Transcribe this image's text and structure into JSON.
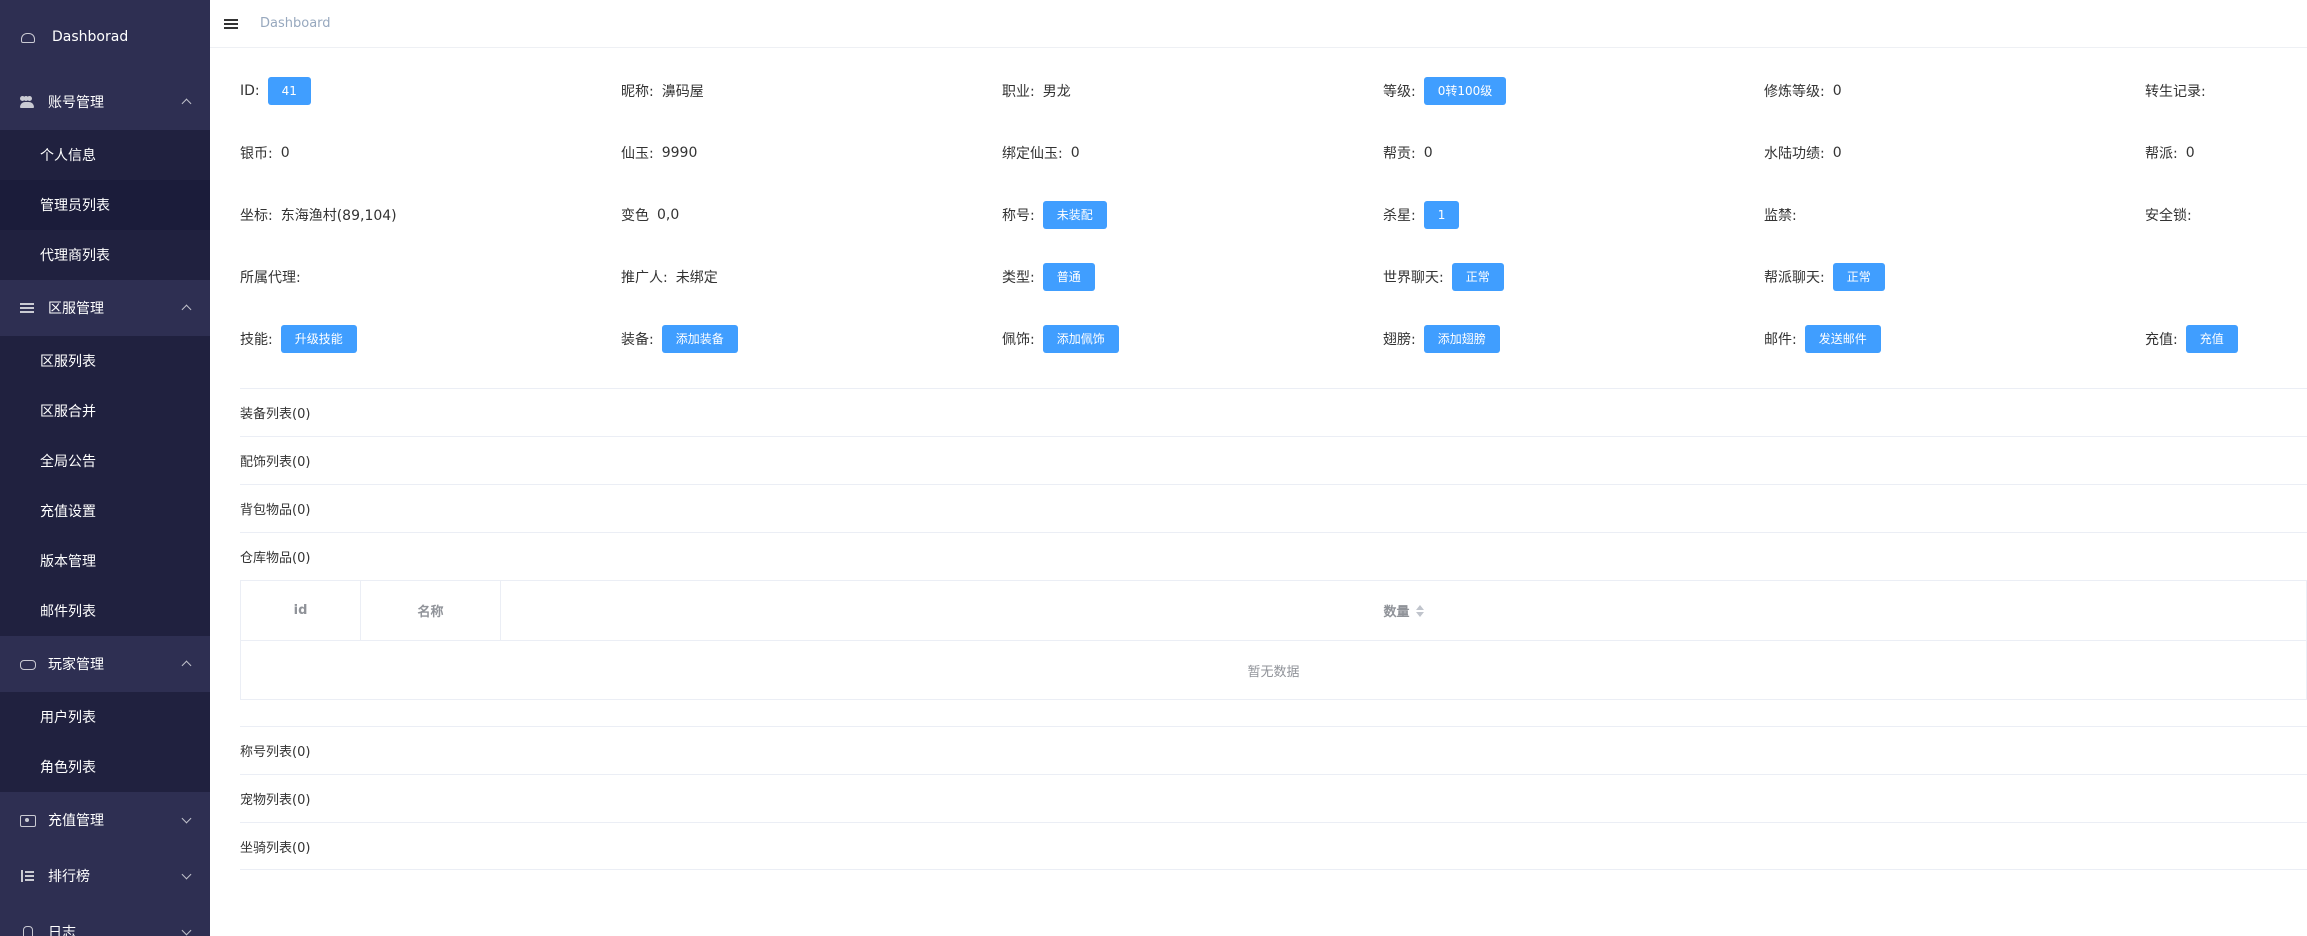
{
  "sidebar": {
    "top": {
      "label": "Dashborad",
      "icon": "dashboard-icon"
    },
    "groups": [
      {
        "label": "账号管理",
        "icon": "users-icon",
        "expanded": true,
        "items": [
          {
            "label": "个人信息"
          },
          {
            "label": "管理员列表"
          },
          {
            "label": "代理商列表"
          }
        ]
      },
      {
        "label": "区服管理",
        "icon": "list-icon",
        "expanded": true,
        "items": [
          {
            "label": "区服列表"
          },
          {
            "label": "区服合并"
          },
          {
            "label": "全局公告"
          },
          {
            "label": "充值设置"
          },
          {
            "label": "版本管理"
          },
          {
            "label": "邮件列表"
          }
        ]
      },
      {
        "label": "玩家管理",
        "icon": "gamepad-icon",
        "expanded": true,
        "items": [
          {
            "label": "用户列表"
          },
          {
            "label": "角色列表"
          }
        ]
      },
      {
        "label": "充值管理",
        "icon": "money-icon",
        "expanded": false
      },
      {
        "label": "排行榜",
        "icon": "rank-icon",
        "expanded": false
      },
      {
        "label": "日志",
        "icon": "bug-icon",
        "expanded": false
      }
    ]
  },
  "topbar": {
    "breadcrumb": "Dashboard"
  },
  "info": {
    "row1": {
      "id_label": "ID:",
      "id_value": "41",
      "nick_label": "昵称:",
      "nick_value": "濞码屋",
      "job_label": "职业:",
      "job_value": "男龙",
      "level_label": "等级:",
      "level_value": "0转100级",
      "cult_label": "修炼等级:",
      "cult_value": "0",
      "reborn_label": "转生记录:"
    },
    "row2": {
      "silver_label": "银币:",
      "silver_value": "0",
      "jade_label": "仙玉:",
      "jade_value": "9990",
      "bound_label": "绑定仙玉:",
      "bound_value": "0",
      "contrib_label": "帮贡:",
      "contrib_value": "0",
      "merit_label": "水陆功绩:",
      "merit_value": "0",
      "faction_label": "帮派:",
      "faction_value": "0"
    },
    "row3": {
      "coord_label": "坐标:",
      "coord_value": "东海渔村(89,104)",
      "color_label": "变色",
      "color_value": "0,0",
      "title_label": "称号:",
      "title_btn": "未装配",
      "kill_label": "杀星:",
      "kill_btn": "1",
      "ban_label": "监禁:",
      "lock_label": "安全锁:"
    },
    "row4": {
      "agent_label": "所属代理:",
      "ref_label": "推广人:",
      "ref_value": "未绑定",
      "type_label": "类型:",
      "type_btn": "普通",
      "world_label": "世界聊天:",
      "world_btn": "正常",
      "fchat_label": "帮派聊天:",
      "fchat_btn": "正常"
    },
    "row5": {
      "skill_label": "技能:",
      "skill_btn": "升级技能",
      "equip_label": "装备:",
      "equip_btn": "添加装备",
      "acc_label": "佩饰:",
      "acc_btn": "添加佩饰",
      "wing_label": "翅膀:",
      "wing_btn": "添加翅膀",
      "mail_label": "邮件:",
      "mail_btn": "发送邮件",
      "recharge_label": "充值:",
      "recharge_btn": "充值"
    }
  },
  "sections": {
    "equip_list": "装备列表(0)",
    "acc_list": "配饰列表(0)",
    "bag_list": "背包物品(0)",
    "warehouse_list": "仓库物品(0)",
    "table": {
      "col_id": "id",
      "col_name": "名称",
      "col_qty": "数量",
      "empty": "暂无数据"
    },
    "title_list": "称号列表(0)",
    "pet_list": "宠物列表(0)",
    "mount_list": "坐骑列表(0)"
  },
  "colors": {
    "sidebar": "#2e2f52",
    "submenu": "#20213f",
    "primary": "#409eff"
  }
}
